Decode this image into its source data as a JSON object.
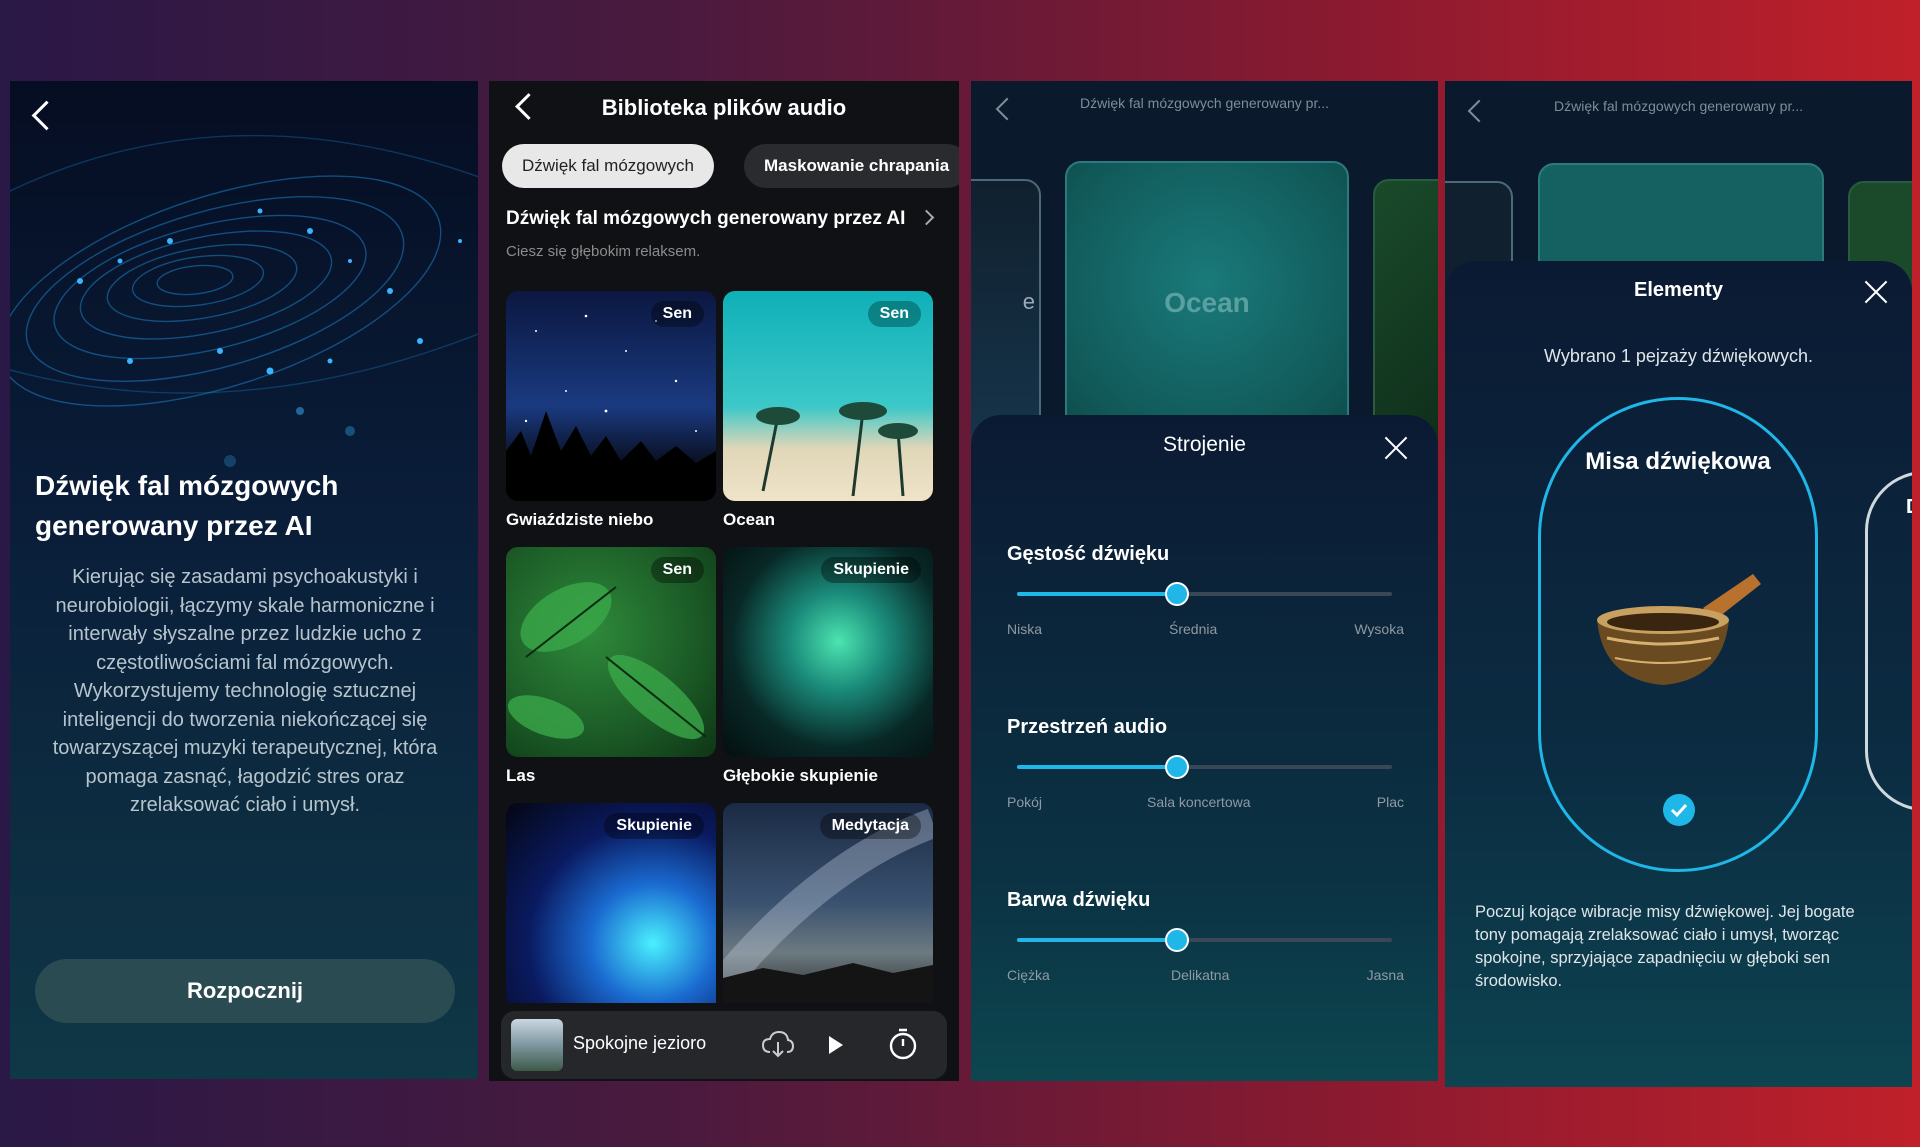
{
  "screen1": {
    "title": "Dźwięk fal mózgowych generowany przez AI",
    "description": "Kierując się zasadami psychoakustyki i neurobiologii, łączymy skale harmoniczne i interwały słyszalne przez ludzkie ucho z częstotliwościami fal mózgowych. Wykorzystujemy technologię sztucznej inteligencji do tworzenia niekończącej się towarzyszącej muzyki terapeutycznej, która pomaga zasnąć, łagodzić stres oraz zrelaksować ciało i umysł.",
    "start_label": "Rozpocznij"
  },
  "screen2": {
    "title": "Biblioteka plików audio",
    "tabs": [
      {
        "label": "Dźwięk fal mózgowych",
        "active": true
      },
      {
        "label": "Maskowanie chrapania",
        "active": false
      }
    ],
    "section_title": "Dźwięk fal mózgowych generowany przez AI",
    "section_subtitle": "Ciesz się głębokim relaksem.",
    "cards": [
      {
        "label": "Gwiaździste niebo",
        "badge": "Sen"
      },
      {
        "label": "Ocean",
        "badge": "Sen"
      },
      {
        "label": "Las",
        "badge": "Sen"
      },
      {
        "label": "Głębokie skupienie",
        "badge": "Skupienie"
      },
      {
        "label": "",
        "badge": "Skupienie"
      },
      {
        "label": "",
        "badge": "Medytacja"
      }
    ],
    "player": {
      "title": "Spokojne jezioro"
    }
  },
  "screen3": {
    "header": "Dźwięk fal mózgowych generowany pr...",
    "card_label": "Ocean",
    "side_label": "e",
    "sheet_title": "Strojenie",
    "sliders": [
      {
        "label": "Gęstość dźwięku",
        "value": 0.42,
        "ticks": [
          "Niska",
          "Średnia",
          "Wysoka"
        ]
      },
      {
        "label": "Przestrzeń audio",
        "value": 0.42,
        "ticks": [
          "Pokój",
          "Sala koncertowa",
          "Plac"
        ]
      },
      {
        "label": "Barwa dźwięku",
        "value": 0.42,
        "ticks": [
          "Ciężka",
          "Delikatna",
          "Jasna"
        ]
      }
    ]
  },
  "screen4": {
    "header": "Dźwięk fal mózgowych generowany pr...",
    "sheet_title": "Elementy",
    "selected_text": "Wybrano 1 pejzaży dźwiękowych.",
    "item_title": "Misa dźwiękowa",
    "next_item_initial": "D",
    "description": "Poczuj kojące wibracje misy dźwiękowej. Jej bogate tony pomagają zrelaksować ciało i umysł, tworząc spokojne, sprzyjające zapadnięciu w głęboki sen środowisko."
  },
  "colors": {
    "accent": "#1fb6e8",
    "button_bg": "#2b4b52"
  }
}
